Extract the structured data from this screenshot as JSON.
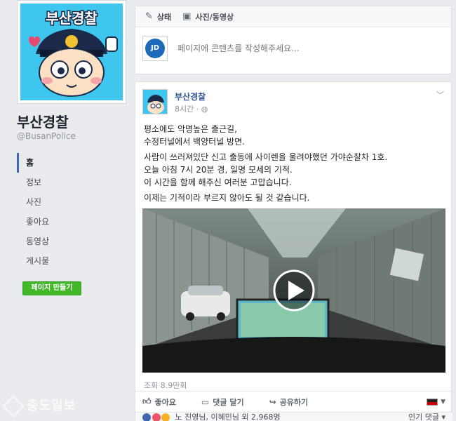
{
  "page": {
    "name": "부산경찰",
    "handle": "@BusanPolice",
    "logo_text": "부산경찰"
  },
  "nav": {
    "items": [
      {
        "label": "홈"
      },
      {
        "label": "정보"
      },
      {
        "label": "사진"
      },
      {
        "label": "좋아요"
      },
      {
        "label": "동영상"
      },
      {
        "label": "게시물"
      }
    ],
    "create_page_label": "페이지 만들기"
  },
  "composer": {
    "tab_status": "상태",
    "tab_photo": "사진/동영상",
    "placeholder": "페이지에 콘텐츠를 작성해주세요...",
    "avatar_text": "JD"
  },
  "post": {
    "author": "부산경찰",
    "time": "8시간",
    "paragraphs": [
      [
        "평소에도 악명높은 출근길,",
        "수정터널에서 백양터널 방면."
      ],
      [
        "사람이 쓰러져있단 신고 출동에 사이렌을 울려야했던 가야순찰차 1호.",
        "오늘 아침 7시 20분 경, 일명 모세의 기적.",
        "이 시간을 함께 해주신 여러분 고맙습니다."
      ],
      [
        "이제는 기적이라 부르지 않아도 될 것 같습니다."
      ]
    ],
    "views": "조회 8.9만회",
    "actions": {
      "like": "좋아요",
      "comment": "댓글 달기",
      "share": "공유하기"
    },
    "reactions_text": "노 진영님, 이혜민님 외 2,968명",
    "reactions_right": "인기 댓글 ▾"
  },
  "watermark": "충도일보",
  "colors": {
    "background": "#e9ebee",
    "link": "#365899",
    "nav_active": "#4267b2",
    "create_button": "#42b72a"
  }
}
